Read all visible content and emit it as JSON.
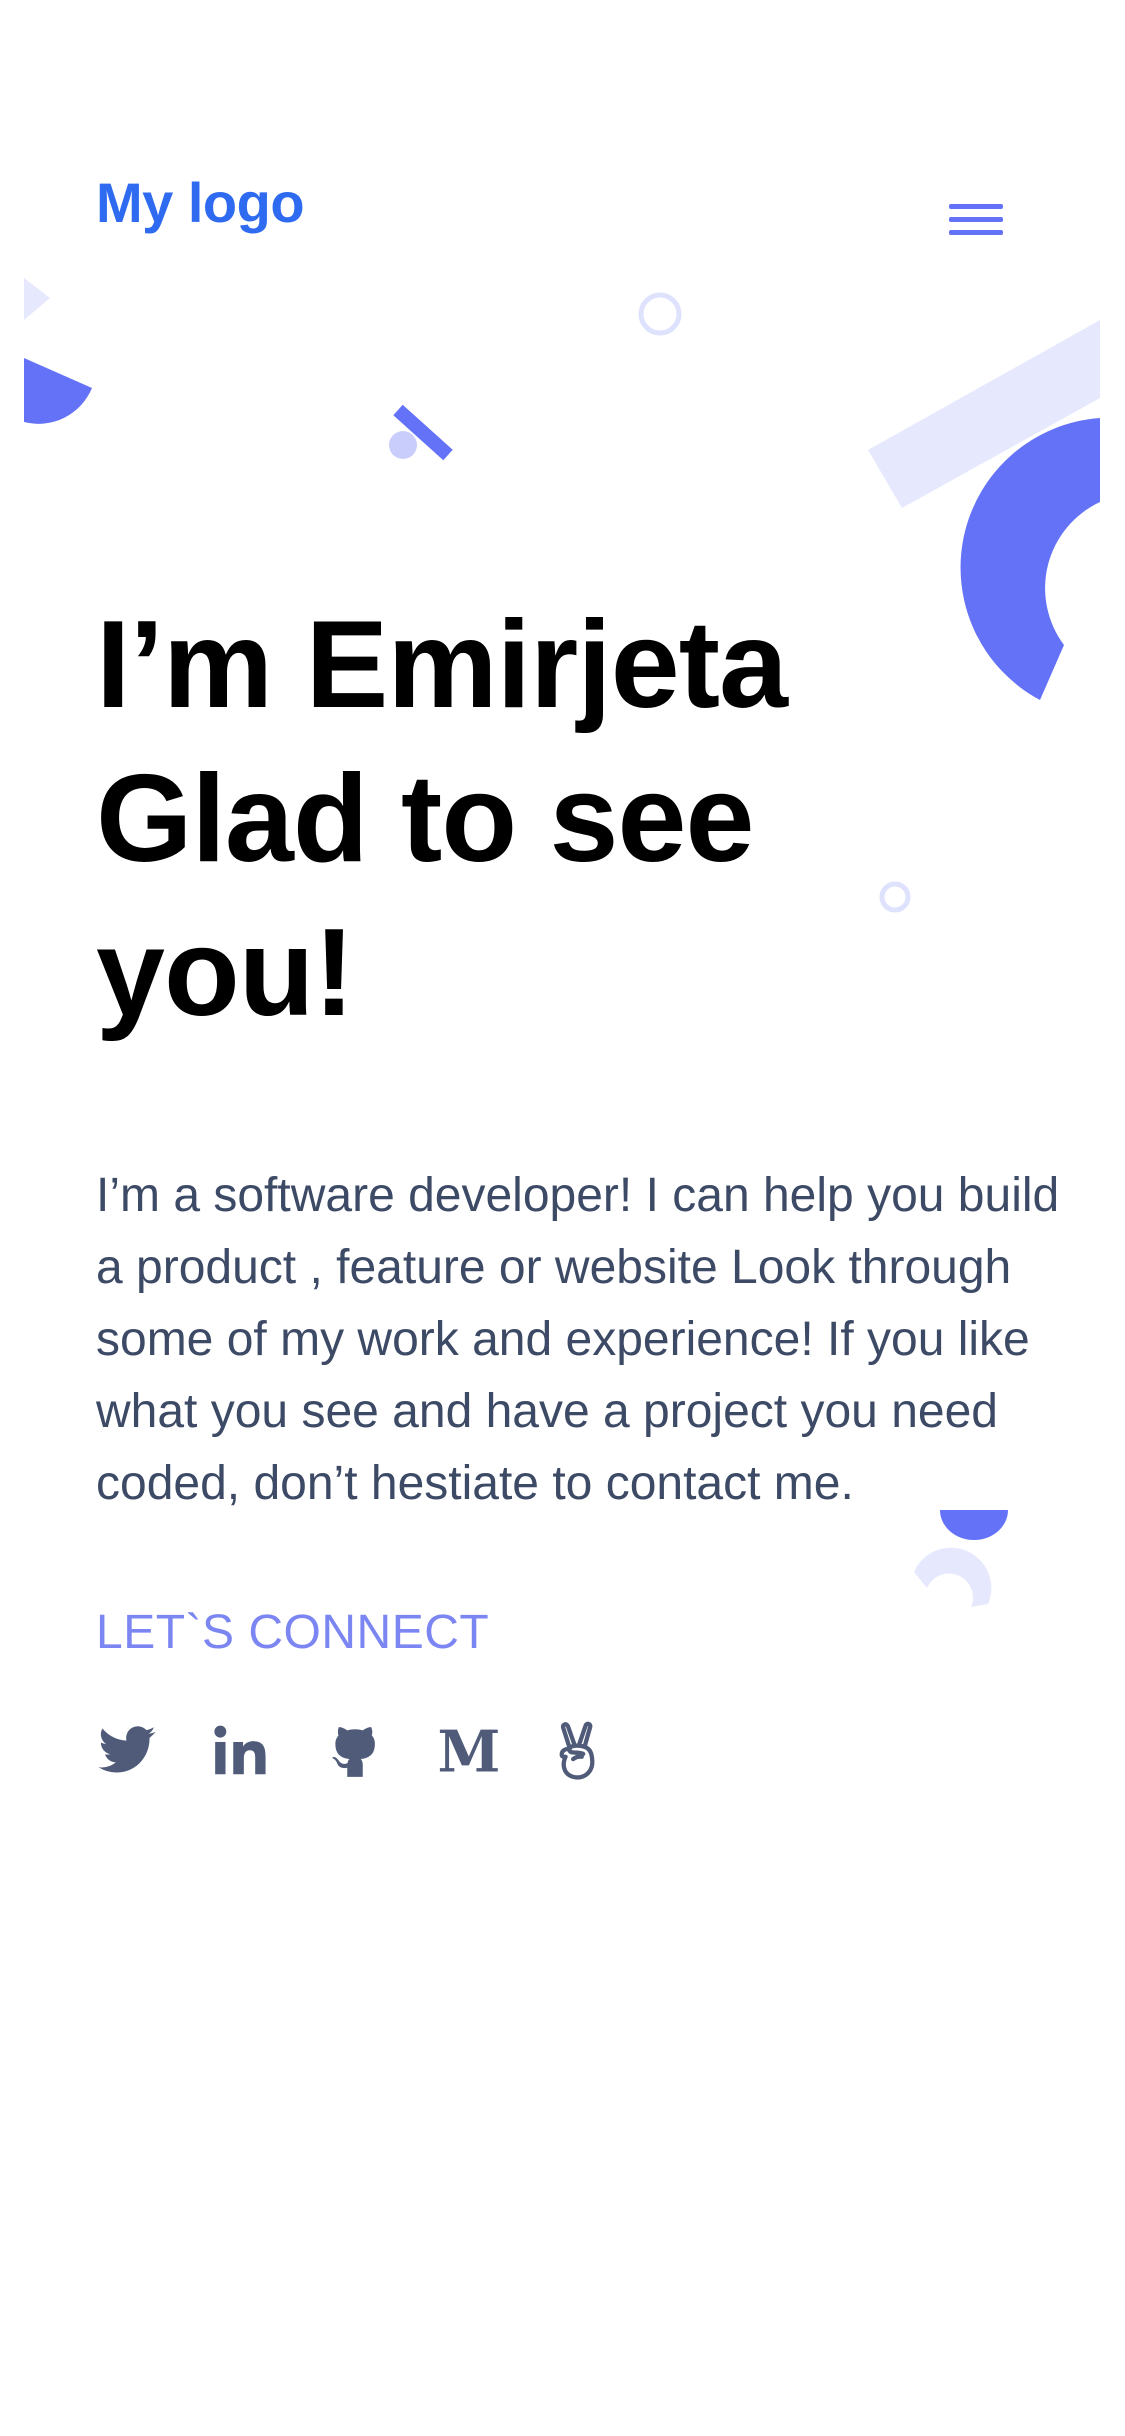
{
  "header": {
    "logo": "My logo",
    "menu_icon": "hamburger-menu-icon"
  },
  "hero": {
    "line1": "I’m Emirjeta",
    "line2": "Glad to see",
    "line3": "you!"
  },
  "intro": {
    "text": "I’m a software developer! I can help you build a product , feature or website Look through some of my work and experience! If you like what you see and have a project you need coded, don’t hestiate to contact me."
  },
  "connect": {
    "label": "LET`S CONNECT"
  },
  "socials": [
    {
      "icon": "twitter-icon"
    },
    {
      "icon": "linkedin-icon"
    },
    {
      "icon": "github-icon"
    },
    {
      "icon": "medium-icon",
      "glyph": "M"
    },
    {
      "icon": "angellist-icon"
    }
  ],
  "colors": {
    "brand": "#2f6bf0",
    "accent": "#6472f7",
    "accent_light": "#e6e8fd",
    "heading": "#000000",
    "body_text": "#3d4a66",
    "link": "#7b86f2",
    "social_icon": "#4f5b78"
  }
}
